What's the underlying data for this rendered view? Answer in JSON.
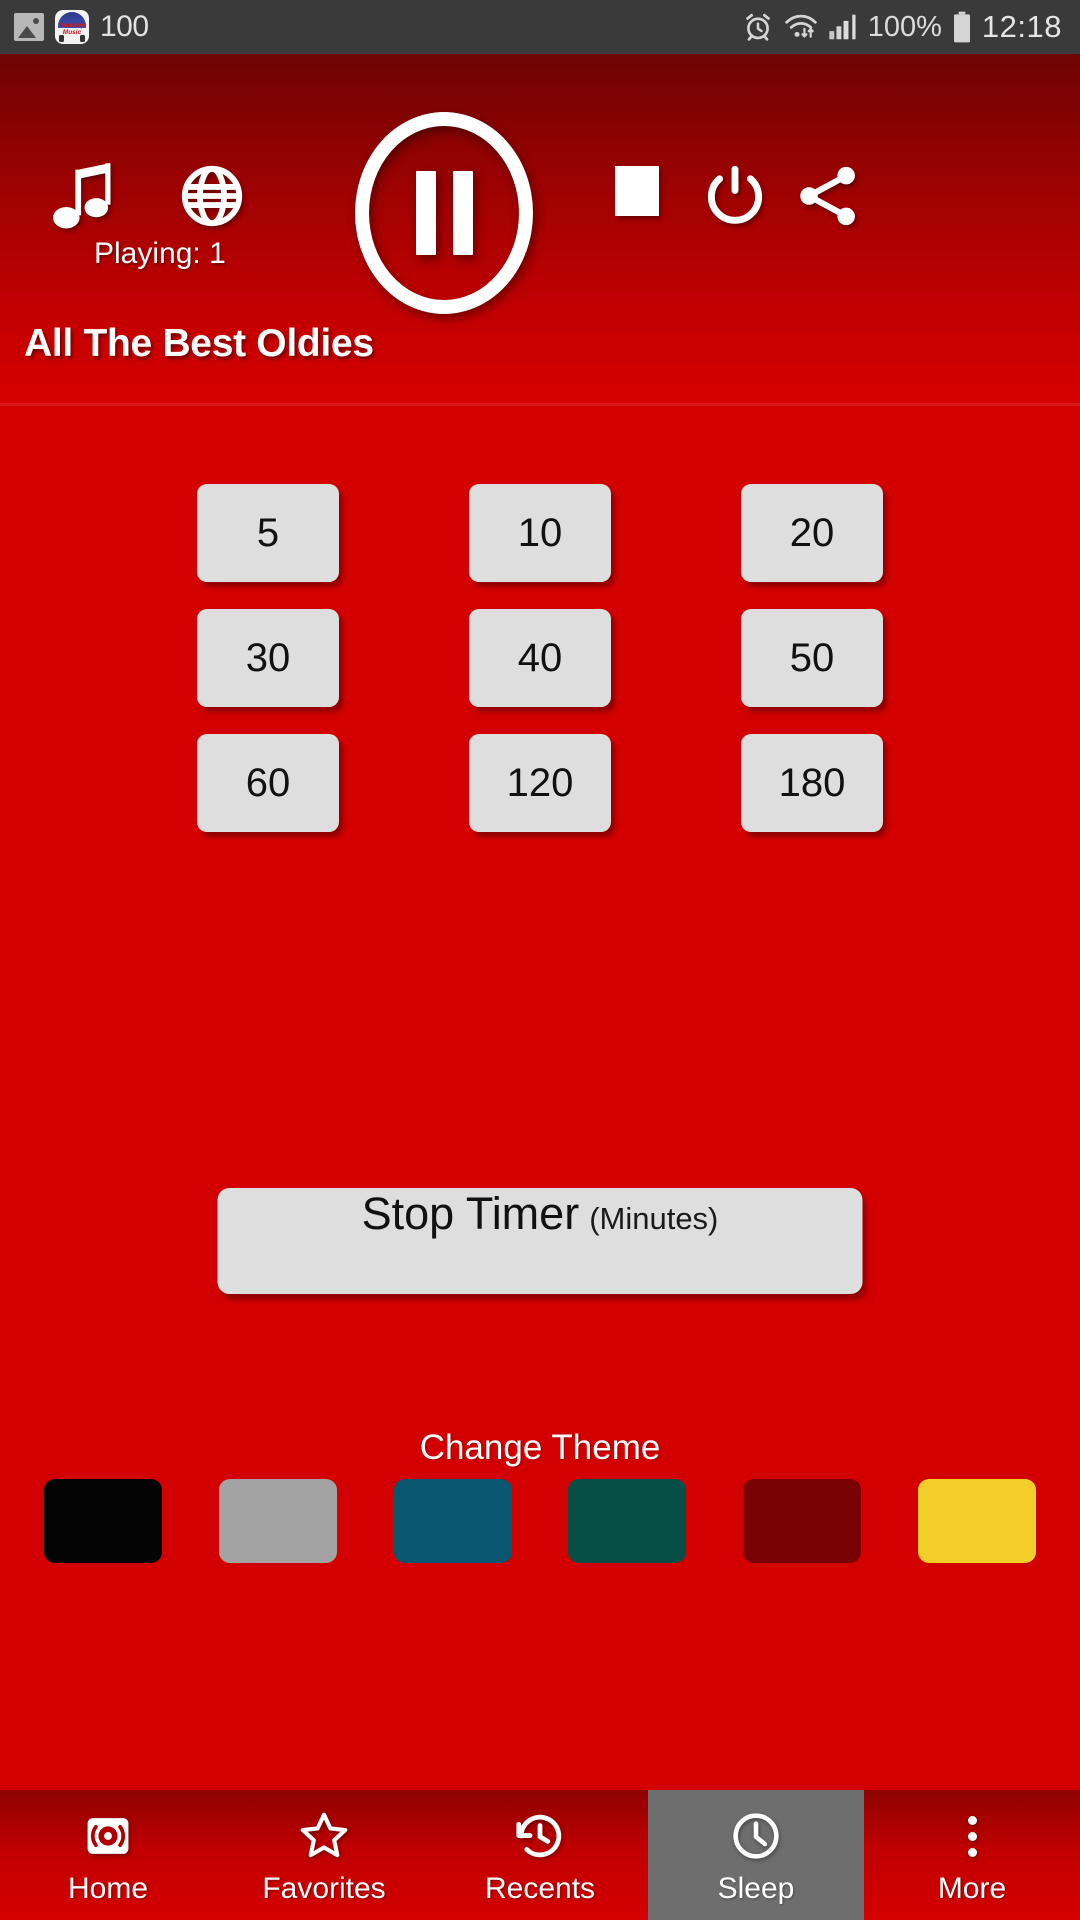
{
  "status_bar": {
    "background": "#3A3A3A",
    "left_icons": [
      {
        "name": "image-icon",
        "label": "image"
      },
      {
        "name": "app-notification-icon",
        "label": "Nonstop Music"
      }
    ],
    "app_badge_line1": "Nonstop",
    "app_badge_line2": "Music",
    "notification_count": "100",
    "right_icons": [
      {
        "name": "alarm-icon",
        "label": "alarm"
      },
      {
        "name": "wifi-icon",
        "label": "wifi"
      },
      {
        "name": "signal-icon",
        "label": "signal"
      }
    ],
    "battery_percent": "100%",
    "time": "12:18"
  },
  "player": {
    "playing_label": "Playing: 1",
    "station_title": "All The Best Oldies",
    "transport_state": "pause",
    "controls": [
      {
        "name": "music-note-icon",
        "label": "Music"
      },
      {
        "name": "globe-icon",
        "label": "Globe"
      },
      {
        "name": "pause-icon",
        "label": "Pause"
      },
      {
        "name": "stop-icon",
        "label": "Stop"
      },
      {
        "name": "power-icon",
        "label": "Power"
      },
      {
        "name": "share-icon",
        "label": "Share"
      }
    ]
  },
  "sleep_timer": {
    "rows": [
      [
        "5",
        "10",
        "20"
      ],
      [
        "30",
        "40",
        "50"
      ],
      [
        "60",
        "120",
        "180"
      ]
    ],
    "stop_button_main": "Stop Timer",
    "stop_button_sub": "(Minutes)"
  },
  "theme": {
    "heading": "Change Theme",
    "swatches": [
      {
        "name": "theme-black",
        "color": "#040404"
      },
      {
        "name": "theme-gray",
        "color": "#A3A3A3"
      },
      {
        "name": "theme-blue",
        "color": "#0A5570"
      },
      {
        "name": "theme-green",
        "color": "#064E46"
      },
      {
        "name": "theme-maroon",
        "color": "#790202"
      },
      {
        "name": "theme-yellow",
        "color": "#F2CE2B"
      }
    ]
  },
  "bottom_nav": {
    "active_index": 3,
    "items": [
      {
        "name": "nav-home",
        "label": "Home",
        "icon": "radio-icon"
      },
      {
        "name": "nav-favorites",
        "label": "Favorites",
        "icon": "star-icon"
      },
      {
        "name": "nav-recents",
        "label": "Recents",
        "icon": "history-icon"
      },
      {
        "name": "nav-sleep",
        "label": "Sleep",
        "icon": "clock-icon"
      },
      {
        "name": "nav-more",
        "label": "More",
        "icon": "overflow-dots-icon"
      }
    ]
  },
  "colors": {
    "background_red": "#D20000",
    "header_dark": "#6E0303",
    "button_gray": "#DEDEDE",
    "active_tab_gray": "#6E6E6E"
  }
}
